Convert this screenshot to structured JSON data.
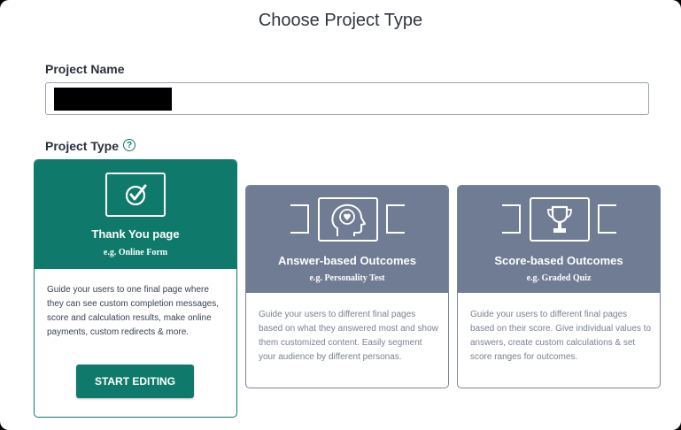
{
  "modal": {
    "title": "Choose Project Type"
  },
  "project_name": {
    "label": "Project Name",
    "value": ""
  },
  "project_type": {
    "label": "Project Type",
    "help_icon": "question-circle-icon"
  },
  "cards": [
    {
      "title": "Thank You page",
      "subtitle": "e.g. Online Form",
      "description": "Guide your users to one final page where they can see custom completion messages, score and calculation results, make online payments, custom redirects & more.",
      "icon": "checkmark-icon",
      "selected": true,
      "button_label": "START EDITING"
    },
    {
      "title": "Answer-based Outcomes",
      "subtitle": "e.g. Personality Test",
      "description": "Guide your users to different final pages based on what they answered most and show them customized content. Easily segment your audience by different personas.",
      "icon": "head-heart-icon",
      "selected": false
    },
    {
      "title": "Score-based Outcomes",
      "subtitle": "e.g. Graded Quiz",
      "description": "Guide your users to different final pages based on their score. Give individual values to answers, create custom calculations & set score ranges for outcomes.",
      "icon": "trophy-icon",
      "selected": false
    }
  ],
  "colors": {
    "accent": "#0f7a6b",
    "card_inactive": "#6f7c93",
    "border": "#9aa3b2"
  }
}
